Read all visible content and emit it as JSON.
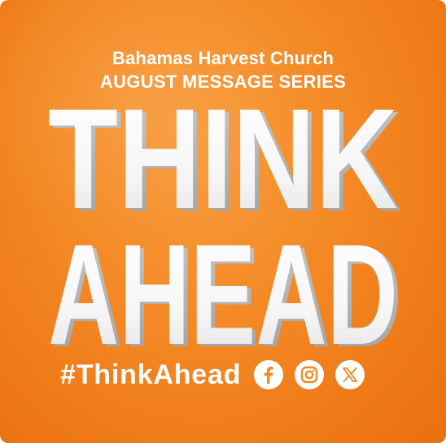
{
  "header": {
    "church_name": "Bahamas Harvest Church",
    "series_label": "AUGUST MESSAGE SERIES"
  },
  "title": {
    "line1": "THINK",
    "line2": "AHEAD"
  },
  "footer": {
    "hashtag": "#ThinkAhead",
    "social": [
      "facebook-icon",
      "instagram-icon",
      "x-icon"
    ]
  },
  "colors": {
    "background": "#f48a26",
    "text": "#ffffff",
    "icon_glyph": "#f48a26"
  }
}
